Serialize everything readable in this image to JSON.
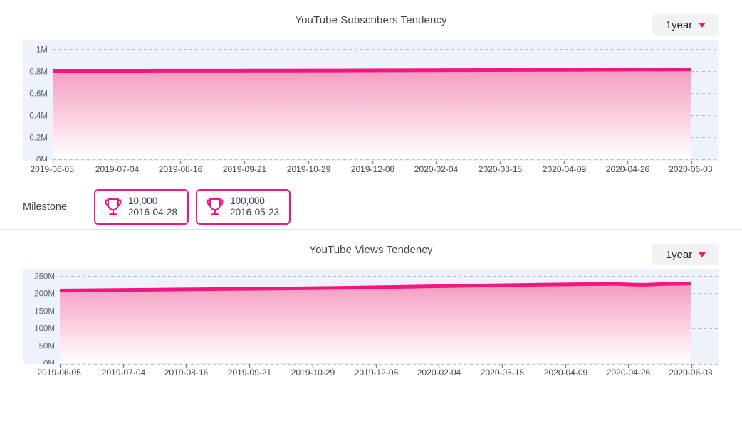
{
  "panels": [
    {
      "id": "subscribers",
      "title": "YouTube Subscribers Tendency",
      "range_label": "1year",
      "caret_icon": "chevron-down-icon",
      "milestone": {
        "label": "Milestone",
        "items": [
          {
            "icon": "trophy-icon",
            "count": "10,000",
            "date": "2016-04-28"
          },
          {
            "icon": "trophy-icon",
            "count": "100,000",
            "date": "2016-05-23"
          }
        ]
      }
    },
    {
      "id": "views",
      "title": "YouTube Views Tendency",
      "range_label": "1year",
      "caret_icon": "chevron-down-icon"
    }
  ],
  "chart_data": [
    {
      "type": "area",
      "id": "subscribers",
      "title": "YouTube Subscribers Tendency",
      "xlabel": "",
      "ylabel": "",
      "ylim": [
        0,
        1000000
      ],
      "ytick_labels": [
        "1M",
        "0.8M",
        "0.6M",
        "0.4M",
        "0.2M",
        "0M"
      ],
      "ytick_values": [
        1000000,
        800000,
        600000,
        400000,
        200000,
        0
      ],
      "grid": true,
      "legend": "none",
      "line_color": "#f5157f",
      "fill_gradient": [
        "#f59bc0",
        "#ffffff"
      ],
      "categories": [
        "2019-06-05",
        "2019-07-04",
        "2019-08-16",
        "2019-09-21",
        "2019-10-29",
        "2019-12-08",
        "2020-02-04",
        "2020-03-15",
        "2020-04-09",
        "2020-04-26",
        "2020-06-03"
      ],
      "series": [
        {
          "name": "Subscribers",
          "values": [
            803000,
            803500,
            804000,
            804500,
            805000,
            806000,
            807500,
            809000,
            810500,
            812000,
            815000
          ]
        }
      ],
      "dense_values": [
        803000,
        803100,
        803200,
        803300,
        803400,
        803500,
        803600,
        803700,
        803800,
        803900,
        804000,
        804100,
        804300,
        804500,
        804700,
        804900,
        805100,
        805300,
        805600,
        805900,
        806200,
        806500,
        806900,
        807300,
        807700,
        808100,
        808500,
        808900,
        809300,
        809700,
        810100,
        810500,
        810900,
        811300,
        811700,
        812100,
        812500,
        813000,
        813600,
        814200,
        813400,
        814600,
        815000
      ]
    },
    {
      "type": "area",
      "id": "views",
      "title": "YouTube Views Tendency",
      "xlabel": "",
      "ylabel": "",
      "ylim": [
        0,
        250000000
      ],
      "ytick_labels": [
        "250M",
        "200M",
        "150M",
        "100M",
        "50M",
        "0M"
      ],
      "ytick_values": [
        250000000,
        200000000,
        150000000,
        100000000,
        50000000,
        0
      ],
      "grid": true,
      "legend": "none",
      "line_color": "#f5157f",
      "fill_gradient": [
        "#f59bc0",
        "#ffffff"
      ],
      "categories": [
        "2019-06-05",
        "2019-07-04",
        "2019-08-16",
        "2019-09-21",
        "2019-10-29",
        "2019-12-08",
        "2020-02-04",
        "2020-03-15",
        "2020-04-09",
        "2020-04-26",
        "2020-06-03"
      ],
      "series": [
        {
          "name": "Views",
          "values": [
            208000000,
            209500000,
            211000000,
            212500000,
            214000000,
            216000000,
            219000000,
            221500000,
            224000000,
            225500000,
            228000000
          ]
        }
      ],
      "dense_values": [
        208000000,
        208400000,
        208800000,
        209200000,
        209600000,
        210000000,
        210400000,
        210800000,
        211200000,
        211600000,
        212000000,
        212400000,
        212800000,
        213200000,
        213600000,
        214000000,
        214500000,
        215000000,
        215500000,
        216000000,
        216700000,
        217400000,
        218100000,
        218800000,
        219500000,
        220200000,
        220900000,
        221600000,
        222300000,
        223000000,
        223600000,
        224200000,
        224800000,
        225400000,
        226000000,
        226400000,
        226800000,
        227100000,
        225200000,
        224600000,
        226800000,
        227800000,
        228200000
      ]
    }
  ]
}
